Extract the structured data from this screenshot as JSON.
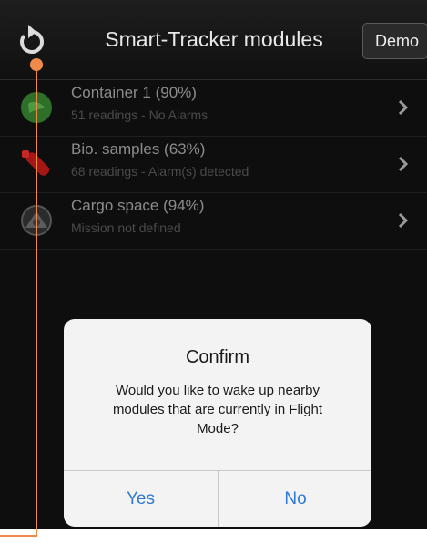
{
  "navbar": {
    "title": "Smart-Tracker modules",
    "demo_label": "Demo",
    "refresh_icon": "refresh-icon"
  },
  "modules": [
    {
      "title": "Container 1 (90%)",
      "subtitle": "51 readings - No Alarms",
      "icon": "green-circle-icon",
      "color": "#2e7d32"
    },
    {
      "title": "Bio. samples (63%)",
      "subtitle": "68 readings - Alarm(s) detected",
      "icon": "red-test-tube-icon",
      "color": "#b71c1c"
    },
    {
      "title": "Cargo space (94%)",
      "subtitle": "Mission not defined",
      "icon": "grey-globe-icon",
      "color": "#555555"
    }
  ],
  "dialog": {
    "title": "Confirm",
    "message": "Would you like to wake up nearby modules that are currently in Flight Mode?",
    "yes_label": "Yes",
    "no_label": "No"
  },
  "colors": {
    "accent_link": "#2f7ad6",
    "callout": "#f08a4b"
  }
}
